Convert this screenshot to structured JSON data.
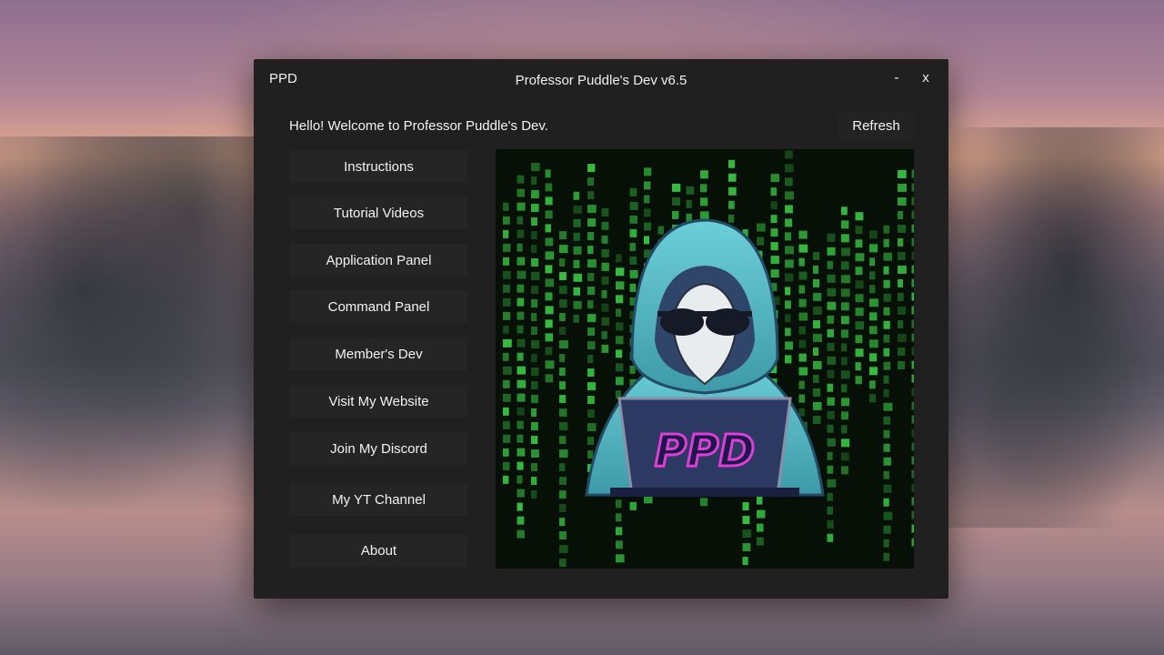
{
  "window": {
    "app_tag": "PPD",
    "title": "Professor Puddle's Dev v6.5",
    "minimize_label": "-",
    "close_label": "x"
  },
  "header": {
    "welcome": "Hello! Welcome to Professor Puddle's Dev.",
    "refresh_label": "Refresh"
  },
  "menu": {
    "items": [
      {
        "label": "Instructions"
      },
      {
        "label": "Tutorial Videos"
      },
      {
        "label": "Application Panel"
      },
      {
        "label": "Command Panel"
      },
      {
        "label": "Member's Dev"
      },
      {
        "label": "Visit My Website"
      },
      {
        "label": "Join My Discord"
      },
      {
        "label": "My YT Channel"
      },
      {
        "label": "About"
      }
    ]
  },
  "banner": {
    "logo_text": "PPD",
    "colors": {
      "matrix_green": "#3fdc4a",
      "hoodie": "#55b9c4",
      "logo_fill": "#1a1a4a",
      "logo_outline": "#e23bd8"
    }
  }
}
